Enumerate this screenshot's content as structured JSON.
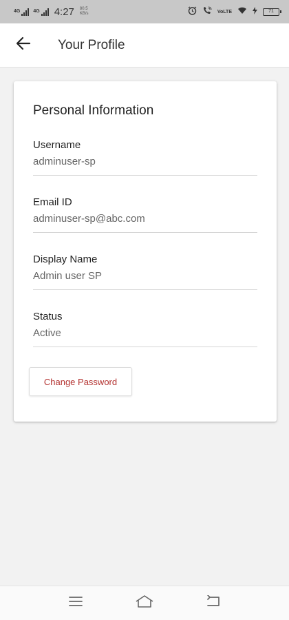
{
  "status_bar": {
    "network_1": "4G",
    "network_2": "4G",
    "time": "4:27",
    "speed_value": "80.5",
    "speed_unit": "KB/s",
    "volte_label": "VoLTE",
    "battery_level": "71"
  },
  "header": {
    "back_icon": "arrow-left-icon",
    "title": "Your Profile"
  },
  "card": {
    "section_title": "Personal Information",
    "fields": [
      {
        "label": "Username",
        "value": "adminuser-sp"
      },
      {
        "label": "Email ID",
        "value": "adminuser-sp@abc.com"
      },
      {
        "label": "Display Name",
        "value": "Admin user SP"
      },
      {
        "label": "Status",
        "value": "Active"
      }
    ],
    "change_password_label": "Change Password"
  },
  "nav_bar": {
    "menu_icon": "menu-icon",
    "home_icon": "home-icon",
    "back_icon": "back-icon"
  },
  "colors": {
    "accent": "#b3312f",
    "status_bar_bg": "#c8c8c8",
    "page_bg": "#f2f2f2"
  }
}
